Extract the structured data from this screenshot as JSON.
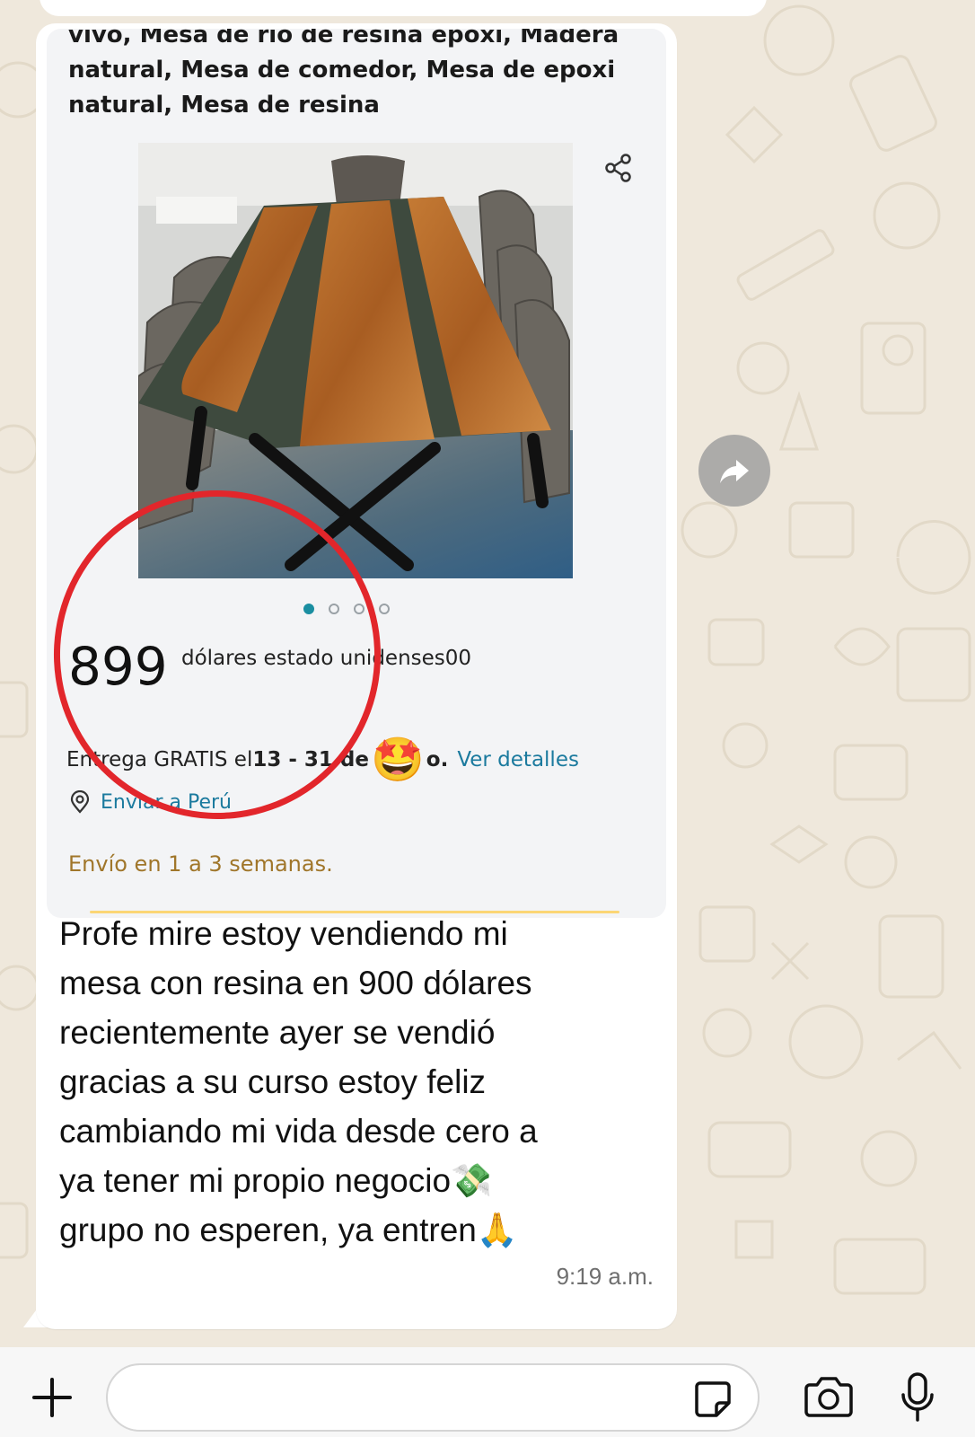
{
  "colors": {
    "wallpaper": "#efe8dc",
    "bubble": "#ffffff",
    "card": "#f3f4f6",
    "link": "#1b7a9e",
    "shipping_time": "#a0762a",
    "annotation_circle": "#e2262b",
    "carousel_active": "#1a8ea1"
  },
  "product": {
    "title_lines": [
      "vivo, Mesa de río de resina epoxi, Madera",
      "natural, Mesa de comedor, Mesa de epoxi",
      "natural, Mesa de resina"
    ],
    "image_icon": "resin-river-dining-table-photo",
    "share_icon": "share-icon",
    "carousel": {
      "count": 4,
      "active_index": 0
    },
    "price": "899",
    "currency_text": "dólares estado unidenses00",
    "delivery": {
      "prefix": "Entrega GRATIS el ",
      "dates": "13 - 31 de",
      "emoji": "🤩",
      "suffix": "o.",
      "link": "Ver detalles"
    },
    "ship_to": {
      "icon": "location-pin-icon",
      "label": "Enviar a Perú"
    },
    "ship_time": "Envío en 1 a 3 semanas."
  },
  "message": {
    "lines": [
      "Profe mire estoy vendiendo mi",
      "mesa con resina en 900 dólares",
      "recientemente ayer se vendió",
      "gracias a su curso estoy feliz",
      "cambiando mi vida desde cero a",
      "ya tener mi propio negocio💸",
      "grupo no esperen, ya entren🙏"
    ],
    "time": "9:19 a.m."
  },
  "actions": {
    "forward_icon": "forward-arrow-icon"
  },
  "composer": {
    "plus_icon": "plus-icon",
    "input_value": "",
    "sticker_icon": "sticker-icon",
    "camera_icon": "camera-icon",
    "mic_icon": "microphone-icon"
  }
}
